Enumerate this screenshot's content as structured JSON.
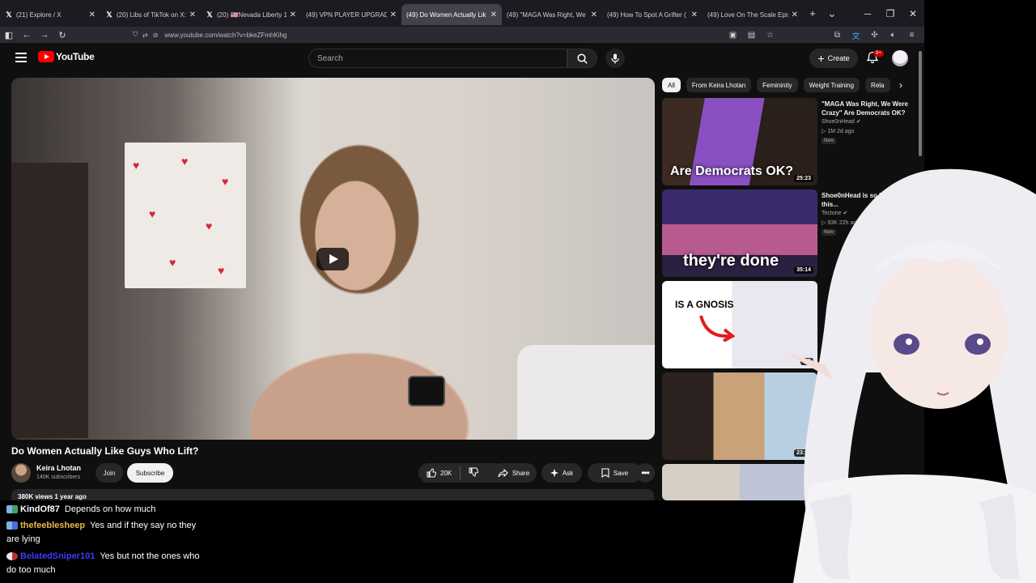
{
  "browser": {
    "tabs": [
      {
        "title": "(21) Explore / X",
        "icon": "x-logo-icon",
        "active": false
      },
      {
        "title": "(20) Libs of TikTok on X: \"Yo",
        "icon": "x-logo-icon",
        "active": false
      },
      {
        "title": "(20) 🇺🇸Nevada Liberty 1864",
        "icon": "x-logo-icon",
        "active": false
      },
      {
        "title": "(49) VPN PLAYER UPGRADE",
        "icon": "youtube-icon",
        "active": false
      },
      {
        "title": "(49) Do Women Actually Lik",
        "icon": "youtube-icon",
        "active": true
      },
      {
        "title": "(49) \"MAGA Was Right, We W",
        "icon": "youtube-icon",
        "active": false
      },
      {
        "title": "(49) How To Spot A Grifter (",
        "icon": "youtube-icon",
        "active": false
      },
      {
        "title": "(49) Love On The Scale Episo",
        "icon": "youtube-icon",
        "active": false
      }
    ],
    "url": "www.youtube.com/watch?v=bkeZFmhKihg"
  },
  "youtube": {
    "logo_text": "YouTube",
    "search_placeholder": "Search",
    "create_label": "Create",
    "notification_count": "9+",
    "video": {
      "title": "Do Women Actually Like Guys Who Lift?",
      "channel": "Keira Lhotan",
      "subscribers": "140K subscribers",
      "join_label": "Join",
      "subscribe_label": "Subscribe",
      "likes": "20K",
      "share_label": "Share",
      "ask_label": "Ask",
      "save_label": "Save",
      "views_line": "380K views 1 year ago"
    },
    "chips": [
      "All",
      "From Keira Lhotan",
      "Femininity",
      "Weight Training",
      "Rela"
    ],
    "recommendations": [
      {
        "title": "\"MAGA Was Right, We Were Crazy\" Are Democrats OK?",
        "channel": "Shoe0nHead",
        "meta": "1M  2d ago",
        "badge": "New",
        "thumb_text": "Are Democrats OK?",
        "duration": "25:23"
      },
      {
        "title": "Shoe0nHead is so Based for this...",
        "channel": "Tectone",
        "meta": "93K  22h ago",
        "badge": "New",
        "thumb_text": "they're done",
        "duration": "35:14"
      },
      {
        "title": "",
        "channel": "",
        "meta": "",
        "badge": "",
        "thumb_text": "IS A GNOSIS",
        "duration": "9:5"
      },
      {
        "title": "",
        "channel": "",
        "meta": "",
        "badge": "",
        "thumb_text": "",
        "duration": "23:57"
      },
      {
        "title": "",
        "channel": "",
        "meta": "",
        "badge": "",
        "thumb_text": "",
        "duration": ""
      }
    ]
  },
  "chat": [
    {
      "user": "KindOf87",
      "text": "Depends on how much",
      "color": "#ffffff"
    },
    {
      "user": "thefeeblesheep",
      "text": "Yes and if they say no they are lying",
      "color": "#e6b94a"
    },
    {
      "user": "BelatedSniper101",
      "text": "Yes but not the ones who do too much",
      "color": "#3a3aff"
    }
  ]
}
